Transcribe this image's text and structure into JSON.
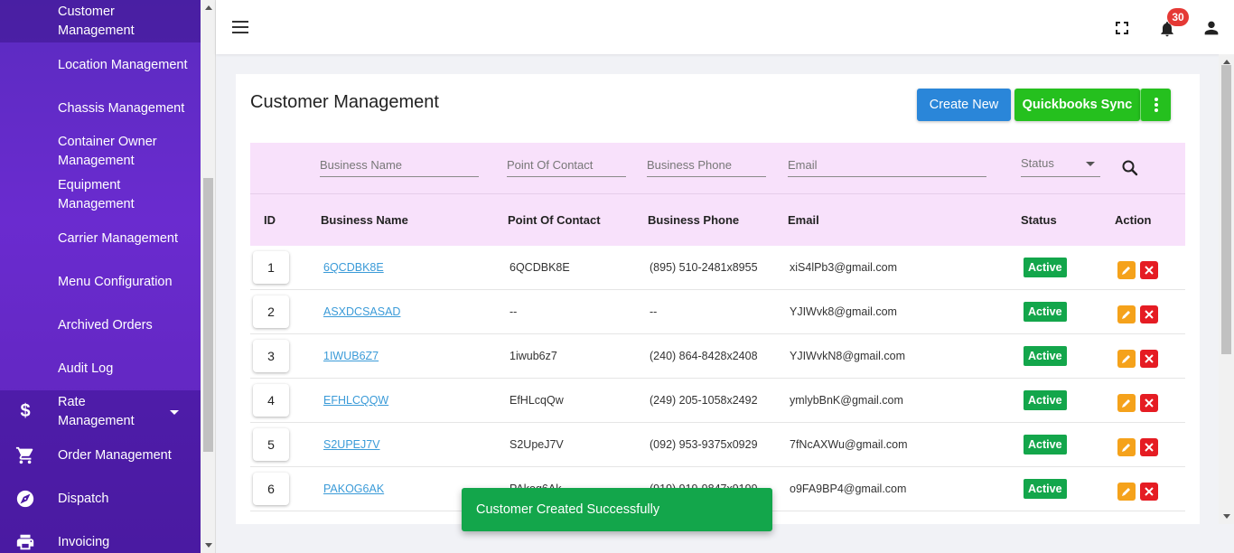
{
  "sidebar": {
    "items": [
      {
        "label": "Customer Management"
      },
      {
        "label": "Location Management"
      },
      {
        "label": "Chassis Management"
      },
      {
        "label": "Container Owner Management"
      },
      {
        "label": "Equipment Management"
      },
      {
        "label": "Carrier Management"
      },
      {
        "label": "Menu Configuration"
      },
      {
        "label": "Archived Orders"
      },
      {
        "label": "Audit Log"
      }
    ],
    "main_items": [
      {
        "label": "Rate Management",
        "icon": "dollar-icon"
      },
      {
        "label": "Order Management",
        "icon": "cart-icon"
      },
      {
        "label": "Dispatch",
        "icon": "compass-icon"
      },
      {
        "label": "Invoicing",
        "icon": "printer-icon"
      }
    ]
  },
  "header": {
    "notification_count": "30"
  },
  "page": {
    "title": "Customer Management",
    "create_label": "Create New",
    "qb_sync_label": "Quickbooks Sync"
  },
  "filters": {
    "business_name": "Business Name",
    "point_of_contact": "Point Of Contact",
    "business_phone": "Business Phone",
    "email": "Email",
    "status": "Status"
  },
  "table": {
    "columns": [
      "ID",
      "Business Name",
      "Point Of Contact",
      "Business Phone",
      "Email",
      "Status",
      "Action"
    ],
    "rows": [
      {
        "id": "1",
        "business_name": "6QCDBK8E",
        "contact": "6QCDBK8E",
        "phone": "(895) 510-2481x8955",
        "email": "xiS4lPb3@gmail.com",
        "status": "Active"
      },
      {
        "id": "2",
        "business_name": "ASXDCSASAD",
        "contact": "--",
        "phone": "--",
        "email": "YJIWvk8@gmail.com",
        "status": "Active"
      },
      {
        "id": "3",
        "business_name": "1IWUB6Z7",
        "contact": "1iwub6z7",
        "phone": "(240) 864-8428x2408",
        "email": "YJIWvkN8@gmail.com",
        "status": "Active"
      },
      {
        "id": "4",
        "business_name": "EFHLCQQW",
        "contact": "EfHLcqQw",
        "phone": "(249) 205-1058x2492",
        "email": "ymlybBnK@gmail.com",
        "status": "Active"
      },
      {
        "id": "5",
        "business_name": "S2UPEJ7V",
        "contact": "S2UpeJ7V",
        "phone": "(092) 953-9375x0929",
        "email": "7fNcAXWu@gmail.com",
        "status": "Active"
      },
      {
        "id": "6",
        "business_name": "PAKOG6AK",
        "contact": "PAkog6Ak",
        "phone": "(919) 919-9847x9199",
        "email": "o9FA9BP4@gmail.com",
        "status": "Active"
      }
    ]
  },
  "toast": {
    "message": "Customer Created Successfully"
  },
  "colors": {
    "sidebar": "#6a2bcf",
    "primary": "#2a86d9",
    "success": "#25c01e",
    "status_active": "#13a64b",
    "edit": "#f5a21b",
    "delete": "#e51c23",
    "table_header": "#f8e1fb"
  }
}
